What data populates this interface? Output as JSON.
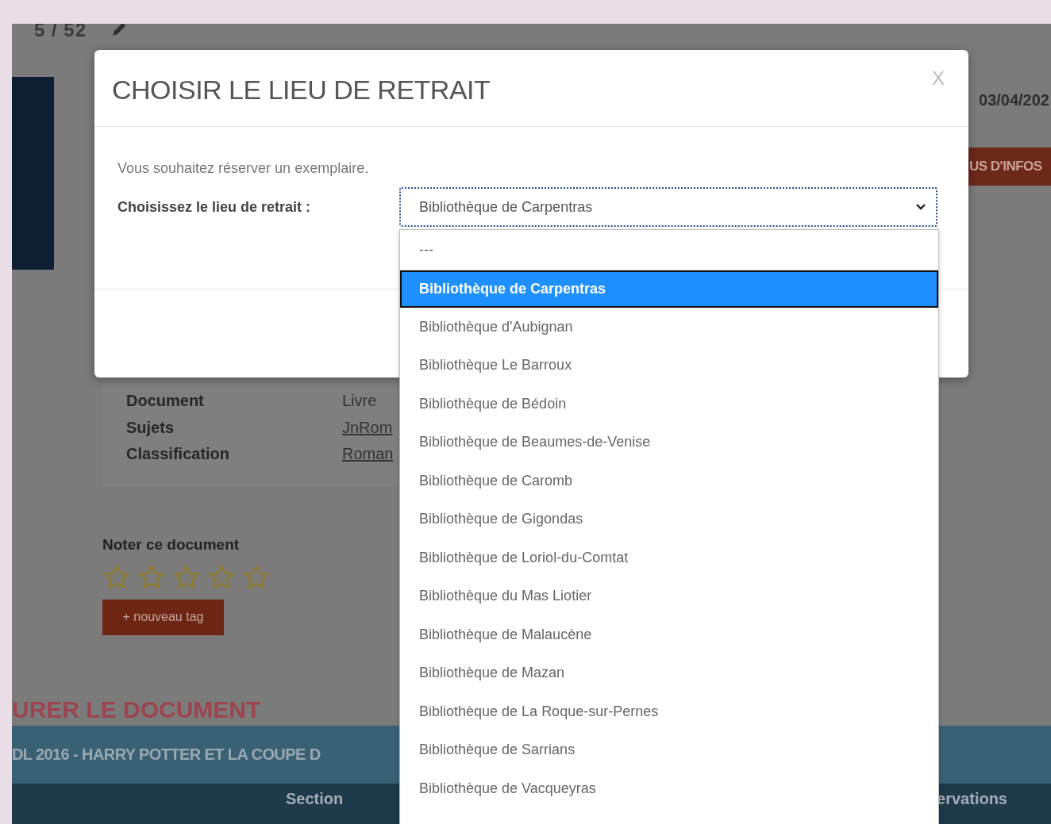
{
  "page": {
    "counter": "5 / 52",
    "date": "03/04/202",
    "more_button": "US D'INFOS",
    "details": [
      {
        "label": "Document",
        "value": "Livre",
        "kind": "text"
      },
      {
        "label": "Sujets",
        "value": "JnRom",
        "kind": "link"
      },
      {
        "label": "Classification",
        "value": "Roman",
        "kind": "link"
      }
    ],
    "rating": {
      "label": "Noter ce document",
      "stars": 0
    },
    "tag_button": "+ nouveau tag",
    "section_heading": "URER LE DOCUMENT",
    "band_title": "DL 2016 - HARRY POTTER ET LA COUPE D",
    "table_header": [
      {
        "label": "Section"
      },
      {
        "label": "ervations"
      }
    ]
  },
  "modal": {
    "title": "CHOISIR LE LIEU DE RETRAIT",
    "close": "X",
    "intro": "Vous souhaitez réserver un exemplaire.",
    "label": "Choisissez le lieu de retrait :",
    "select": {
      "value": "Bibliothèque de Carpentras",
      "expanded": true,
      "options": [
        {
          "label": "---",
          "selected": false
        },
        {
          "label": "Bibliothèque de Carpentras",
          "selected": true
        },
        {
          "label": "Bibliothèque d'Aubignan",
          "selected": false
        },
        {
          "label": "Bibliothèque Le Barroux",
          "selected": false
        },
        {
          "label": "Bibliothèque de Bédoin",
          "selected": false
        },
        {
          "label": "Bibliothèque de Beaumes-de-Venise",
          "selected": false
        },
        {
          "label": "Bibliothèque de Caromb",
          "selected": false
        },
        {
          "label": "Bibliothèque de Gigondas",
          "selected": false
        },
        {
          "label": "Bibliothèque de Loriol-du-Comtat",
          "selected": false
        },
        {
          "label": "Bibliothèque du Mas Liotier",
          "selected": false
        },
        {
          "label": "Bibliothèque de Malaucène",
          "selected": false
        },
        {
          "label": "Bibliothèque de Mazan",
          "selected": false
        },
        {
          "label": "Bibliothèque de La Roque-sur-Pernes",
          "selected": false
        },
        {
          "label": "Bibliothèque de Sarrians",
          "selected": false
        },
        {
          "label": "Bibliothèque de Vacqueyras",
          "selected": false
        }
      ]
    }
  }
}
